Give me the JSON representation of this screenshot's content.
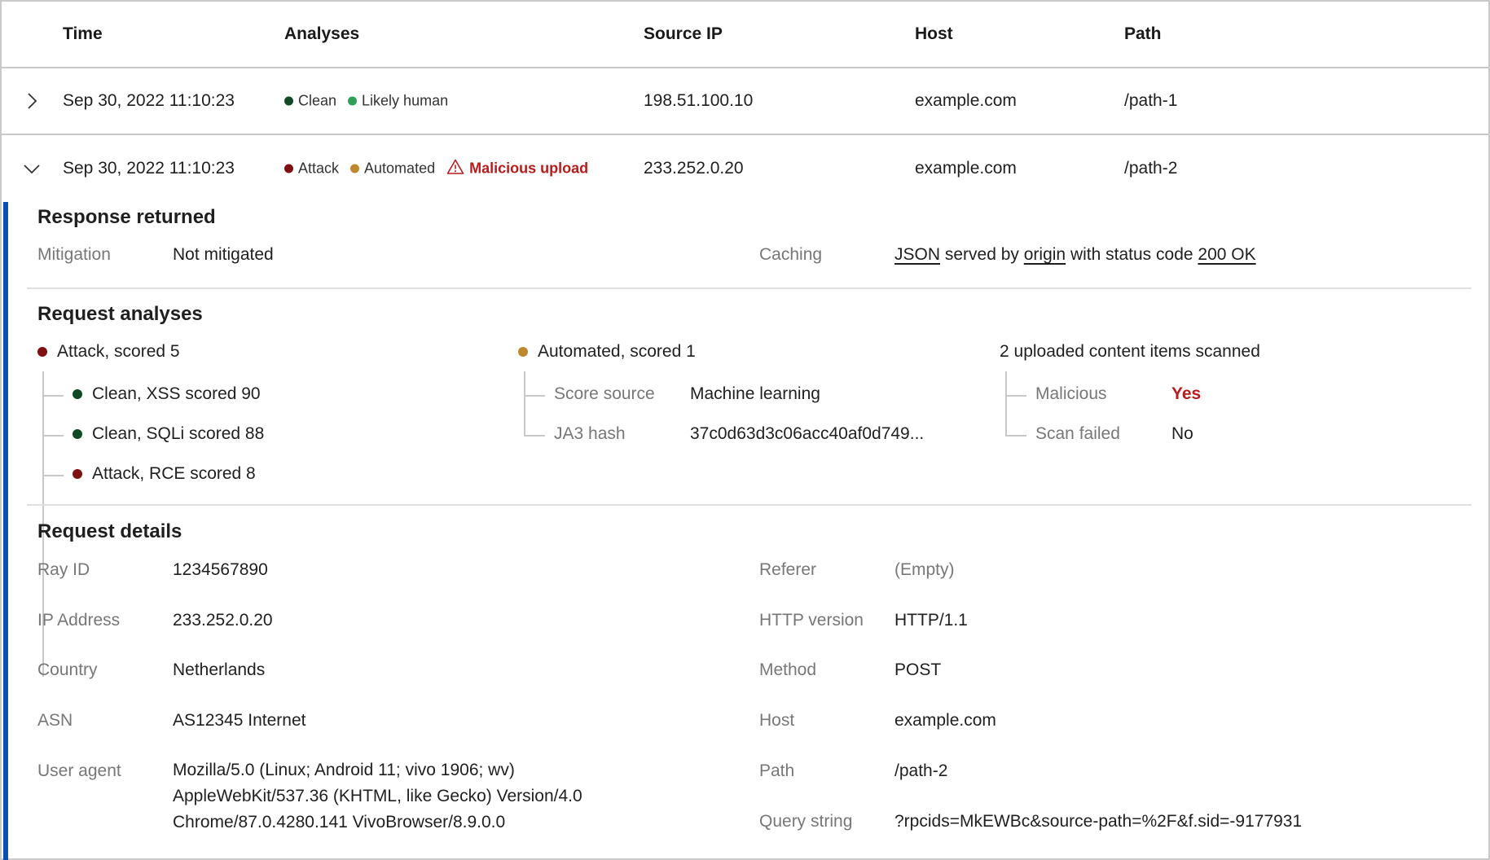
{
  "table": {
    "columns": [
      "Time",
      "Analyses",
      "Source IP",
      "Host",
      "Path"
    ],
    "rows": [
      {
        "expanded": false,
        "time": "Sep 30, 2022 11:10:23",
        "analyses": [
          {
            "label": "Clean",
            "color": "#0f4a24"
          },
          {
            "label": "Likely human",
            "color": "#2ea05a"
          }
        ],
        "source_ip": "198.51.100.10",
        "host": "example.com",
        "path": "/path-1"
      },
      {
        "expanded": true,
        "time": "Sep 30, 2022 11:10:23",
        "analyses": [
          {
            "label": "Attack",
            "color": "#7d1010"
          },
          {
            "label": "Automated",
            "color": "#c0882e"
          }
        ],
        "warning": "Malicious upload",
        "source_ip": "233.252.0.20",
        "host": "example.com",
        "path": "/path-2"
      }
    ]
  },
  "details": {
    "response": {
      "title": "Response returned",
      "mitigation_label": "Mitigation",
      "mitigation_value": "Not mitigated",
      "caching_label": "Caching",
      "caching": {
        "content_type": "JSON",
        "text1": "served by",
        "served_by": "origin",
        "text2": "with status code",
        "status": "200 OK"
      }
    },
    "analyses": {
      "title": "Request analyses",
      "attack": {
        "label": "Attack, scored 5",
        "color": "#7d1010",
        "children": [
          {
            "label": "Clean, XSS scored 90",
            "color": "#0f4a24"
          },
          {
            "label": "Clean, SQLi scored 88",
            "color": "#0f4a24"
          },
          {
            "label": "Attack, RCE scored 8",
            "color": "#7d1010"
          }
        ]
      },
      "automated": {
        "label": "Automated, scored 1",
        "color": "#c0882e",
        "children": [
          {
            "label": "Score source",
            "value": "Machine learning"
          },
          {
            "label": "JA3 hash",
            "value": "37c0d63d3c06acc40af0d749..."
          }
        ]
      },
      "upload": {
        "label": "2 uploaded content items scanned",
        "children": [
          {
            "label": "Malicious",
            "value": "Yes"
          },
          {
            "label": "Scan failed",
            "value": "No"
          }
        ]
      }
    },
    "request": {
      "title": "Request details",
      "left": [
        {
          "label": "Ray ID",
          "value": "1234567890"
        },
        {
          "label": "IP Address",
          "value": "233.252.0.20"
        },
        {
          "label": "Country",
          "value": "Netherlands"
        },
        {
          "label": "ASN",
          "value": "AS12345 Internet"
        },
        {
          "label": "User agent",
          "value_lines": [
            "Mozilla/5.0 (Linux; Android 11; vivo 1906; wv)",
            "AppleWebKit/537.36 (KHTML, like Gecko) Version/4.0",
            "Chrome/87.0.4280.141 VivoBrowser/8.9.0.0"
          ]
        }
      ],
      "right": [
        {
          "label": "Referer",
          "value": "(Empty)"
        },
        {
          "label": "HTTP version",
          "value": "HTTP/1.1"
        },
        {
          "label": "Method",
          "value": "POST"
        },
        {
          "label": "Host",
          "value": "example.com"
        },
        {
          "label": "Path",
          "value": "/path-2"
        },
        {
          "label": "Query string",
          "value": "?rpcids=MkEWBc&source-path=%2F&f.sid=-9177931"
        }
      ]
    }
  },
  "colors": {
    "accent_bar": "#0a4fb3",
    "danger": "#b71c1c"
  }
}
